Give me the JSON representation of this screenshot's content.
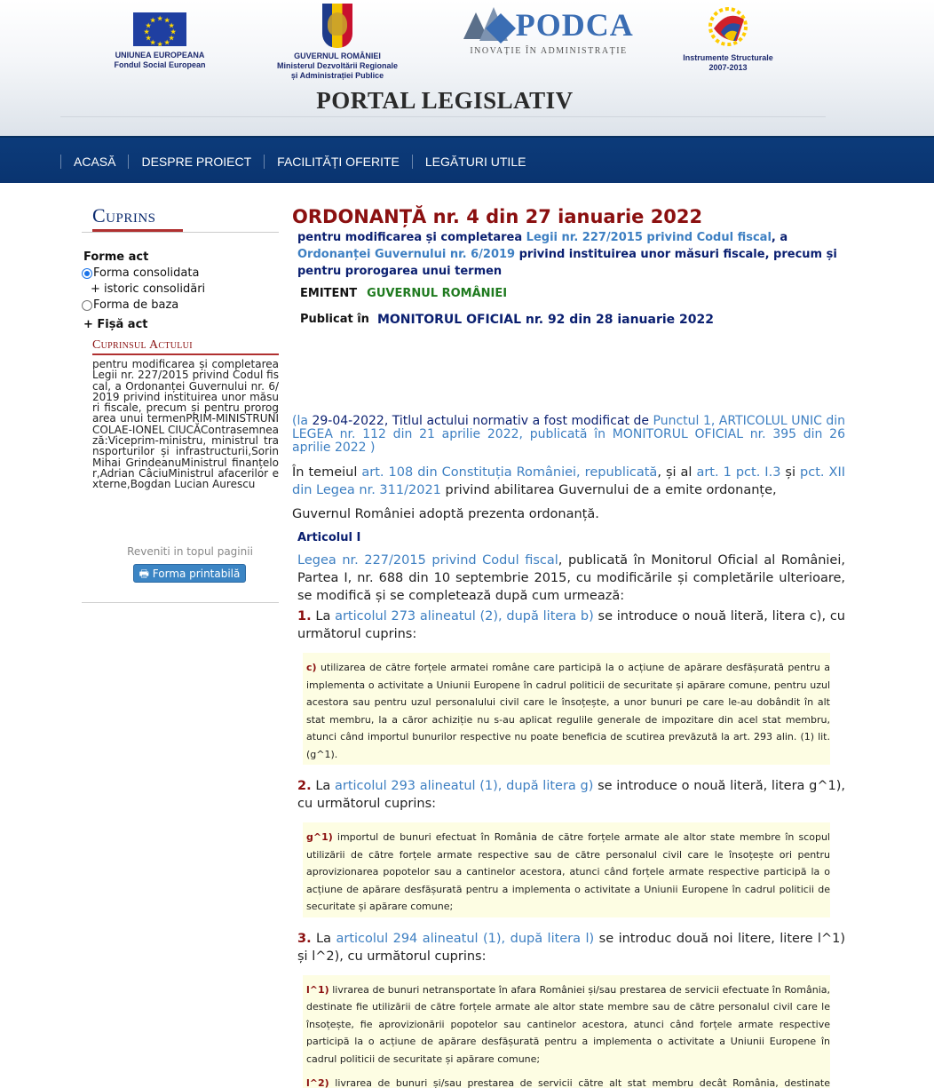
{
  "header": {
    "logos": {
      "eu": {
        "line1": "UNIUNEA EUROPEANA",
        "line2": "Fondul Social European"
      },
      "ro": {
        "line1": "GUVERNUL ROMÂNIEI",
        "line2": "Ministerul Dezvoltării Regionale",
        "line3": "și Administrației Publice"
      },
      "podca": {
        "name": "PODCA",
        "tagline": "INOVAȚIE ÎN ADMINISTRAȚIE"
      },
      "is": {
        "line1": "Instrumente Structurale",
        "line2": "2007-2013"
      }
    },
    "title": "PORTAL LEGISLATIV"
  },
  "nav": {
    "items": [
      "ACASĂ",
      "DESPRE PROIECT",
      "FACILITĂȚI OFERITE",
      "LEGĂTURI UTILE"
    ]
  },
  "sidebar": {
    "title": "Cuprins",
    "forme_label": "Forme act",
    "option_consolidata": "Forma consolidata",
    "istoric": "+ istoric consolidări",
    "option_baza": "Forma de baza",
    "fisa": "+ Fișă act",
    "cuprinsul_title": "Cuprinsul Actului",
    "toc_text": "pentru modificarea și completarea Legii nr. 227/2015 privind Codul fiscal, a Ordonanței Guvernului nr. 6/2019 privind instituirea unor măsuri fiscale, precum și pentru prorogarea unui termenPRIM-MINISTRUNICOLAE-IONEL CIUCĂContrasemnează:Viceprim-ministru, ministrul transporturilor și infrastructurii,Sorin Mihai GrindeanuMinistrul finanțelor,Adrian CâciuMinistrul afacerilor externe,Bogdan Lucian Aurescu",
    "back_top": "Reveniti in topul paginii",
    "print": "Forma printabilă"
  },
  "act": {
    "title": "ORDONANȚĂ nr. 4 din 27 ianuarie 2022",
    "subtitle": {
      "p1": "pentru modificarea și completarea ",
      "l1": "Legii nr. 227/2015 privind Codul fiscal",
      "p2": ", a ",
      "l2": "Ordonanței Guvernului nr. 6/2019",
      "p3": " privind instituirea unor măsuri fiscale, precum și pentru prorogarea unui termen"
    },
    "emitent_label": "EMITENT",
    "emitent_value": "GUVERNUL ROMÂNIEI",
    "publicat_label": "Publicat în",
    "publicat_value": "MONITORUL OFICIAL nr. 92 din 28 ianuarie 2022",
    "modif_note": {
      "open": "(la ",
      "date": "29-04-2022",
      "text": ", Titlul actului normativ a fost modificat de ",
      "link": "Punctul 1, ARTICOLUL UNIC din LEGEA nr. 112 din 21 aprilie 2022, publicată în MONITORUL OFICIAL nr. 395 din 26 aprilie 2022",
      "close": " )"
    },
    "temei": {
      "t1": "În temeiul ",
      "l1": "art. 108 din Constituția României, republicată",
      "t2": ", și al ",
      "l2": "art. 1 pct. I.3",
      "t3": " și ",
      "l3": "pct. XII din Legea nr. 311/2021",
      "t4": " privind abilitarea Guvernului de a emite ordonanțe,"
    },
    "adopta": "Guvernul României adoptă prezenta ordonanță.",
    "article_title": "Articolul I",
    "article_intro": {
      "link": "Legea nr. 227/2015 privind Codul fiscal",
      "text": ", publicată în Monitorul Oficial al României, Partea I, nr. 688 din 10 septembrie 2015, cu modificările și completările ulterioare, se modifică și se completează după cum urmează:"
    },
    "points": [
      {
        "num": "1.",
        "t1": " La ",
        "link": "articolul 273 alineatul (2), după litera b)",
        "t2": " se introduce o nouă literă, litera c), cu următorul cuprins:",
        "quotes": [
          {
            "label": "c)",
            "text": " utilizarea de către forțele armatei române care participă la o acțiune de apărare desfășurată pentru a implementa o activitate a Uniunii Europene în cadrul politicii de securitate și apărare comune, pentru uzul acestora sau pentru uzul personalului civil care le însoțește, a unor bunuri pe care le-au dobândit în alt stat membru, la a căror achiziție nu s-au aplicat regulile generale de impozitare din acel stat membru, atunci când importul bunurilor respective nu poate beneficia de scutirea prevăzută la art. 293 alin. (1) lit. (g^1)."
          }
        ]
      },
      {
        "num": "2.",
        "t1": " La ",
        "link": "articolul 293 alineatul (1), după litera g)",
        "t2": " se introduce o nouă literă, litera g^1), cu următorul cuprins:",
        "quotes": [
          {
            "label": "g^1)",
            "text": " importul de bunuri efectuat în România de către forțele armate ale altor state membre în scopul utilizării de către forțele armate respective sau de către personalul civil care le însoțește ori pentru aprovizionarea popotelor sau a cantinelor acestora, atunci când forțele armate respective participă la o acțiune de apărare desfășurată pentru a implementa o activitate a Uniunii Europene în cadrul politicii de securitate și apărare comune;"
          }
        ]
      },
      {
        "num": "3.",
        "t1": " La ",
        "link": "articolul 294 alineatul (1), după litera l)",
        "t2": " se introduc două noi litere, litere l^1) și l^2), cu următorul cuprins:",
        "quotes": [
          {
            "label": "l^1)",
            "text": " livrarea de bunuri netransportate în afara României și/sau prestarea de servicii efectuate în România, destinate fie utilizării de către forțele armate ale altor state membre sau de către personalul civil care le însoțește, fie aprovizionării popotelor sau cantinelor acestora, atunci când forțele armate respective participă la o acțiune de apărare desfășurată pentru a implementa o activitate a Uniunii Europene în cadrul politicii de securitate și apărare comune;"
          },
          {
            "label": "l^2)",
            "text": " livrarea de bunuri și/sau prestarea de servicii către alt stat membru decât România, destinate forțelor armate ale oricărui alt stat membru decât statul membru de destinație, în scopul utilizării de"
          }
        ]
      }
    ]
  }
}
